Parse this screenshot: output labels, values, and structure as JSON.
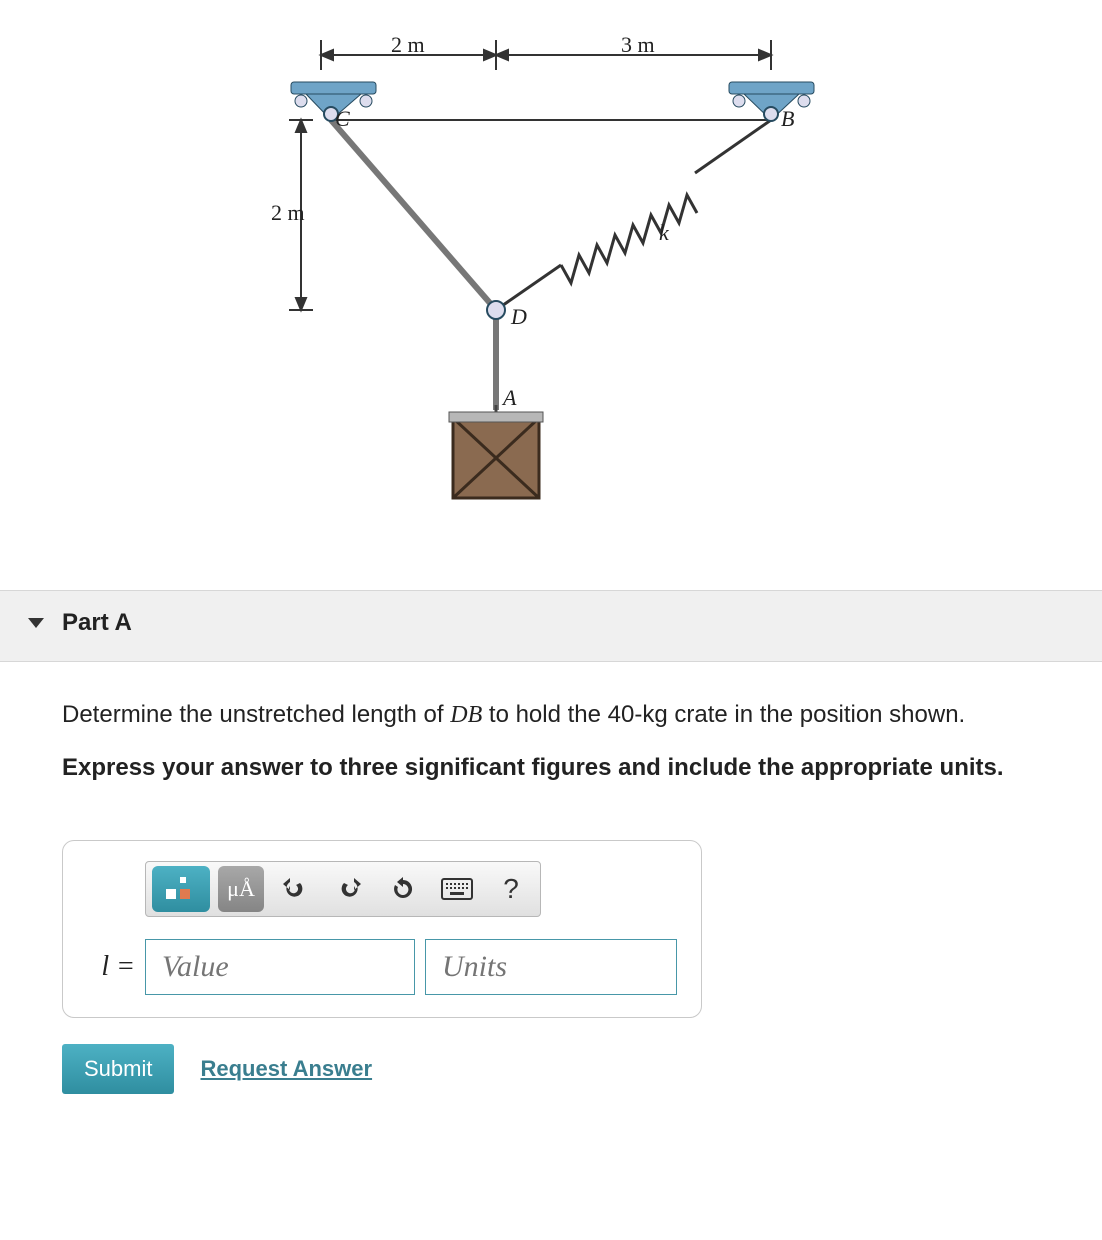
{
  "diagram": {
    "dim_top_left": "2 m",
    "dim_top_right": "3 m",
    "dim_vert": "2 m",
    "C": "C",
    "B": "B",
    "D": "D",
    "A": "A",
    "k": "k"
  },
  "part": {
    "title": "Part A",
    "question_pre": "Determine the unstretched length of ",
    "question_sym": "DB",
    "question_mid": " to hold the 40-",
    "question_unit": "kg",
    "question_post": " crate in the position shown.",
    "instruction": "Express your answer to three significant figures and include the appropriate units."
  },
  "answer": {
    "lhs": "l =",
    "value_placeholder": "Value",
    "units_placeholder": "Units",
    "mu_label": "μÅ",
    "help": "?"
  },
  "buttons": {
    "submit": "Submit",
    "request": "Request Answer"
  }
}
